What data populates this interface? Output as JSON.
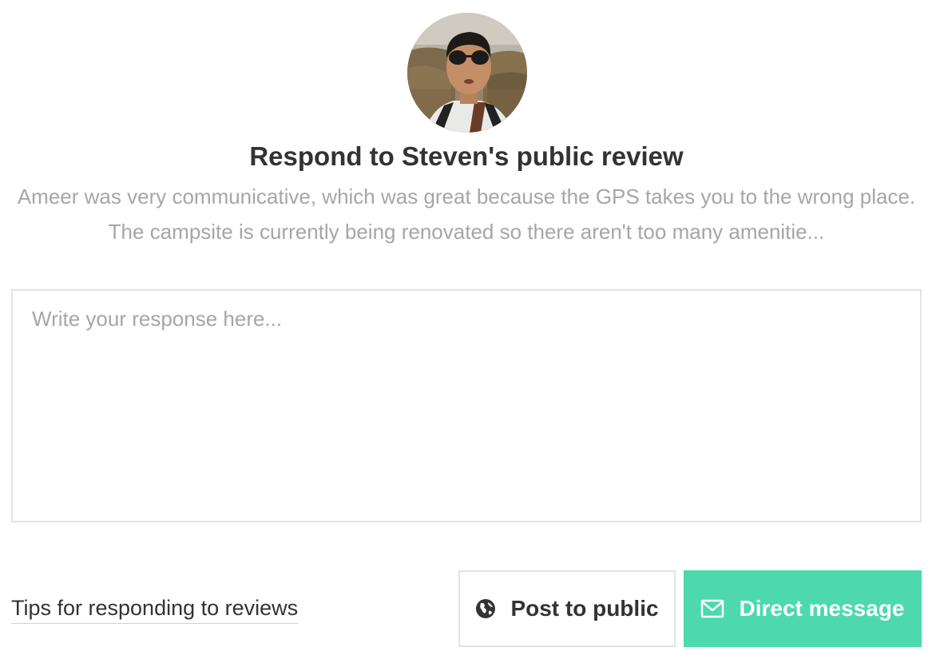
{
  "reviewer": {
    "avatar_alt": "Steven"
  },
  "header": {
    "title": "Respond to Steven's public review"
  },
  "review": {
    "excerpt": "Ameer was very communicative, which was great because the GPS takes you to the wrong place. The campsite is currently being renovated so there aren't too many amenitie..."
  },
  "response": {
    "placeholder": "Write your response here...",
    "value": ""
  },
  "footer": {
    "tips_link": "Tips for responding to reviews",
    "post_public_label": "Post to public",
    "direct_message_label": "Direct message"
  },
  "icons": {
    "post_public": "globe-icon",
    "direct_message": "envelope-icon"
  },
  "colors": {
    "primary_button": "#4dd9ac",
    "muted_text": "#a6a6a6",
    "heading_text": "#333333",
    "border": "#e4e4e4"
  }
}
